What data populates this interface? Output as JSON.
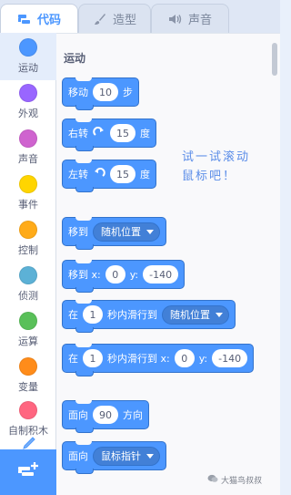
{
  "tabs": [
    {
      "label": "代码",
      "icon": "code-icon",
      "active": true
    },
    {
      "label": "造型",
      "icon": "brush-icon",
      "active": false
    },
    {
      "label": "声音",
      "icon": "speaker-icon",
      "active": false
    }
  ],
  "categories": [
    {
      "label": "运动",
      "color": "#4c97ff",
      "active": true
    },
    {
      "label": "外观",
      "color": "#9966ff",
      "active": false
    },
    {
      "label": "声音",
      "color": "#cf63cf",
      "active": false
    },
    {
      "label": "事件",
      "color": "#ffd500",
      "active": false
    },
    {
      "label": "控制",
      "color": "#ffab19",
      "active": false
    },
    {
      "label": "侦测",
      "color": "#5cb1d6",
      "active": false
    },
    {
      "label": "运算",
      "color": "#59c059",
      "active": false
    },
    {
      "label": "变量",
      "color": "#ff8c1a",
      "active": false
    },
    {
      "label": "自制积木",
      "color": "#ff6680",
      "active": false
    }
  ],
  "palette": {
    "section_title": "运动",
    "blocks": {
      "move": {
        "text1": "移动",
        "value": "10",
        "text2": "步"
      },
      "turn_right": {
        "text1": "右转",
        "value": "15",
        "text2": "度"
      },
      "turn_left": {
        "text1": "左转",
        "value": "15",
        "text2": "度"
      },
      "goto": {
        "text1": "移到",
        "dropdown": "随机位置"
      },
      "goto_xy": {
        "text1": "移到 x:",
        "x": "0",
        "text2": "y:",
        "y": "-140"
      },
      "glide": {
        "text1": "在",
        "secs": "1",
        "text2": "秒内滑行到",
        "dropdown": "随机位置"
      },
      "glide_xy": {
        "text1": "在",
        "secs": "1",
        "text2": "秒内滑行到 x:",
        "x": "0",
        "text3": "y:",
        "y": "-140"
      },
      "point_dir": {
        "text1": "面向",
        "value": "90",
        "text2": "方向"
      },
      "point_towards": {
        "text1": "面向",
        "dropdown": "鼠标指针"
      }
    }
  },
  "hint": {
    "line1": "试一试滚动",
    "line2": "鼠标吧！"
  },
  "watermark": "大猫鸟叔叔",
  "colors": {
    "motion": "#4c97ff",
    "accent": "#4c97ff"
  }
}
